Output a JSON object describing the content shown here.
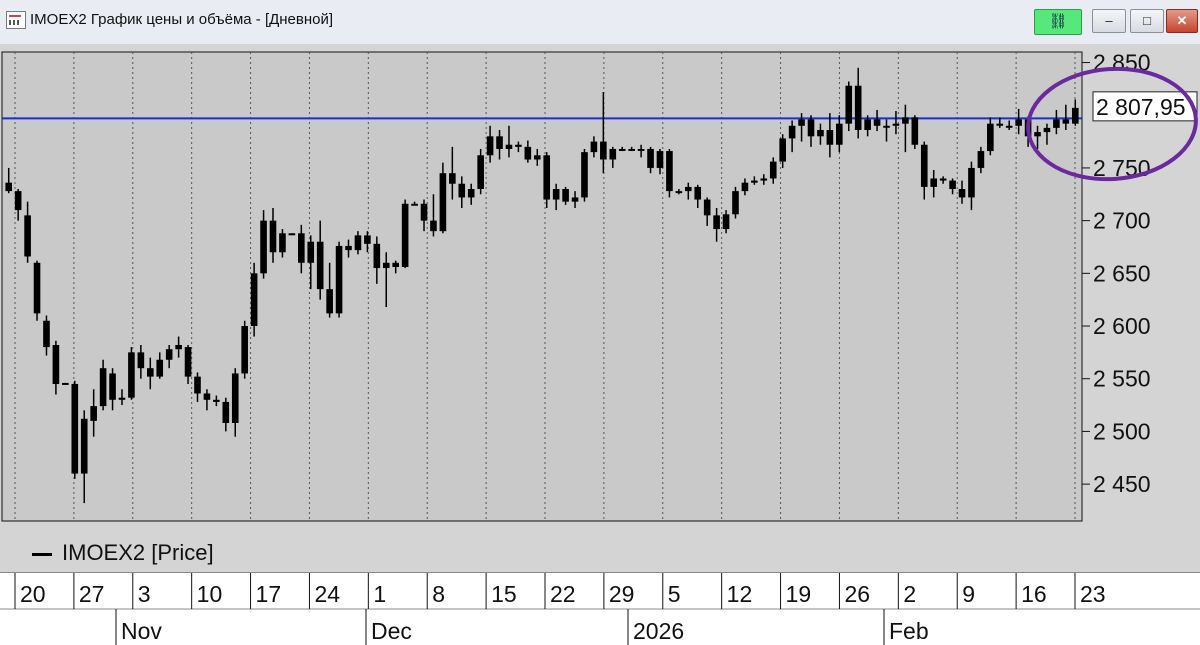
{
  "window": {
    "title": "IMOEX2 График цены и объёма - [Дневной]",
    "link_icon": "link-icon",
    "minimize_label": "–",
    "maximize_label": "□",
    "close_label": "✕"
  },
  "legend": {
    "label": "IMOEX2 [Price]"
  },
  "annotation": {
    "shape": "hand-drawn ellipse",
    "color": "#6a2a9e"
  },
  "chart_data": {
    "type": "candlestick",
    "series_name": "IMOEX2 [Price]",
    "y_ticks": [
      "2 850",
      "2 750",
      "2 700",
      "2 650",
      "2 600",
      "2 550",
      "2 500",
      "2 450"
    ],
    "y_range": [
      2415,
      2860
    ],
    "last_value": 2807.95,
    "last_value_label": "2 807,95",
    "reference_line": {
      "value": 2797,
      "color": "#1a2ed8"
    },
    "x_day_ticks": [
      "20",
      "27",
      "3",
      "10",
      "17",
      "24",
      "1",
      "8",
      "15",
      "22",
      "29",
      "5",
      "12",
      "19",
      "26",
      "2",
      "9",
      "16",
      "23"
    ],
    "x_month_labels": [
      "Nov",
      "Dec",
      "2026",
      "Feb"
    ],
    "ohlc": [
      [
        2736,
        2750,
        2726,
        2728
      ],
      [
        2728,
        2730,
        2700,
        2710
      ],
      [
        2705,
        2718,
        2660,
        2666
      ],
      [
        2660,
        2662,
        2605,
        2612
      ],
      [
        2605,
        2610,
        2572,
        2580
      ],
      [
        2582,
        2586,
        2535,
        2545
      ],
      [
        2545,
        2546,
        2545,
        2546
      ],
      [
        2545,
        2548,
        2455,
        2460
      ],
      [
        2460,
        2520,
        2432,
        2512
      ],
      [
        2510,
        2540,
        2495,
        2524
      ],
      [
        2524,
        2568,
        2520,
        2560
      ],
      [
        2555,
        2560,
        2520,
        2530
      ],
      [
        2530,
        2540,
        2525,
        2532
      ],
      [
        2532,
        2580,
        2530,
        2575
      ],
      [
        2575,
        2582,
        2550,
        2560
      ],
      [
        2560,
        2570,
        2540,
        2552
      ],
      [
        2552,
        2575,
        2550,
        2568
      ],
      [
        2568,
        2582,
        2560,
        2578
      ],
      [
        2578,
        2590,
        2570,
        2582
      ],
      [
        2580,
        2582,
        2545,
        2552
      ],
      [
        2552,
        2556,
        2528,
        2536
      ],
      [
        2536,
        2540,
        2520,
        2530
      ],
      [
        2530,
        2534,
        2524,
        2528
      ],
      [
        2528,
        2532,
        2500,
        2508
      ],
      [
        2508,
        2560,
        2495,
        2555
      ],
      [
        2555,
        2605,
        2550,
        2600
      ],
      [
        2600,
        2660,
        2590,
        2650
      ],
      [
        2650,
        2710,
        2645,
        2700
      ],
      [
        2700,
        2712,
        2660,
        2670
      ],
      [
        2670,
        2692,
        2665,
        2688
      ],
      [
        2688,
        2688,
        2687,
        2688
      ],
      [
        2688,
        2696,
        2650,
        2660
      ],
      [
        2660,
        2686,
        2635,
        2680
      ],
      [
        2680,
        2700,
        2625,
        2635
      ],
      [
        2635,
        2660,
        2608,
        2612
      ],
      [
        2612,
        2680,
        2608,
        2676
      ],
      [
        2676,
        2682,
        2665,
        2672
      ],
      [
        2672,
        2690,
        2668,
        2686
      ],
      [
        2686,
        2690,
        2670,
        2678
      ],
      [
        2678,
        2685,
        2640,
        2655
      ],
      [
        2655,
        2670,
        2618,
        2660
      ],
      [
        2660,
        2662,
        2650,
        2656
      ],
      [
        2656,
        2720,
        2655,
        2716
      ],
      [
        2716,
        2718,
        2715,
        2716
      ],
      [
        2716,
        2720,
        2690,
        2700
      ],
      [
        2700,
        2725,
        2685,
        2690
      ],
      [
        2690,
        2755,
        2688,
        2745
      ],
      [
        2745,
        2770,
        2720,
        2735
      ],
      [
        2735,
        2742,
        2712,
        2722
      ],
      [
        2722,
        2735,
        2715,
        2730
      ],
      [
        2730,
        2768,
        2725,
        2762
      ],
      [
        2762,
        2790,
        2755,
        2780
      ],
      [
        2780,
        2786,
        2758,
        2768
      ],
      [
        2768,
        2790,
        2760,
        2772
      ],
      [
        2772,
        2775,
        2765,
        2770
      ],
      [
        2770,
        2776,
        2755,
        2758
      ],
      [
        2758,
        2768,
        2752,
        2762
      ],
      [
        2762,
        2765,
        2712,
        2720
      ],
      [
        2720,
        2735,
        2710,
        2730
      ],
      [
        2730,
        2732,
        2715,
        2718
      ],
      [
        2718,
        2728,
        2712,
        2722
      ],
      [
        2722,
        2768,
        2718,
        2765
      ],
      [
        2765,
        2780,
        2760,
        2775
      ],
      [
        2775,
        2822,
        2745,
        2758
      ],
      [
        2758,
        2770,
        2750,
        2768
      ],
      [
        2768,
        2770,
        2766,
        2768
      ],
      [
        2768,
        2770,
        2766,
        2768
      ],
      [
        2768,
        2772,
        2760,
        2768
      ],
      [
        2768,
        2770,
        2745,
        2750
      ],
      [
        2750,
        2768,
        2744,
        2766
      ],
      [
        2766,
        2768,
        2722,
        2728
      ],
      [
        2728,
        2730,
        2725,
        2728
      ],
      [
        2728,
        2736,
        2720,
        2732
      ],
      [
        2732,
        2734,
        2712,
        2720
      ],
      [
        2720,
        2722,
        2695,
        2705
      ],
      [
        2705,
        2712,
        2680,
        2692
      ],
      [
        2692,
        2710,
        2688,
        2706
      ],
      [
        2706,
        2732,
        2702,
        2728
      ],
      [
        2728,
        2740,
        2724,
        2736
      ],
      [
        2736,
        2742,
        2734,
        2738
      ],
      [
        2738,
        2744,
        2734,
        2740
      ],
      [
        2740,
        2760,
        2735,
        2756
      ],
      [
        2756,
        2782,
        2750,
        2778
      ],
      [
        2778,
        2795,
        2765,
        2790
      ],
      [
        2790,
        2802,
        2775,
        2796
      ],
      [
        2796,
        2800,
        2770,
        2780
      ],
      [
        2780,
        2792,
        2772,
        2786
      ],
      [
        2786,
        2802,
        2760,
        2772
      ],
      [
        2772,
        2800,
        2765,
        2792
      ],
      [
        2792,
        2832,
        2785,
        2828
      ],
      [
        2828,
        2845,
        2778,
        2786
      ],
      [
        2786,
        2800,
        2780,
        2796
      ],
      [
        2796,
        2805,
        2785,
        2790
      ],
      [
        2790,
        2796,
        2775,
        2790
      ],
      [
        2790,
        2804,
        2782,
        2792
      ],
      [
        2792,
        2810,
        2765,
        2798
      ],
      [
        2798,
        2800,
        2768,
        2772
      ],
      [
        2772,
        2775,
        2720,
        2732
      ],
      [
        2732,
        2748,
        2722,
        2740
      ],
      [
        2740,
        2742,
        2735,
        2738
      ],
      [
        2738,
        2740,
        2725,
        2730
      ],
      [
        2730,
        2738,
        2716,
        2722
      ],
      [
        2722,
        2756,
        2710,
        2750
      ],
      [
        2750,
        2770,
        2745,
        2766
      ],
      [
        2766,
        2798,
        2762,
        2792
      ],
      [
        2792,
        2798,
        2788,
        2790
      ],
      [
        2790,
        2795,
        2786,
        2790
      ],
      [
        2790,
        2806,
        2782,
        2796
      ],
      [
        2796,
        2799,
        2770,
        2780
      ],
      [
        2780,
        2790,
        2768,
        2784
      ],
      [
        2784,
        2792,
        2772,
        2788
      ],
      [
        2788,
        2805,
        2782,
        2796
      ],
      [
        2796,
        2810,
        2786,
        2792
      ],
      [
        2792,
        2815,
        2790,
        2807
      ]
    ]
  }
}
